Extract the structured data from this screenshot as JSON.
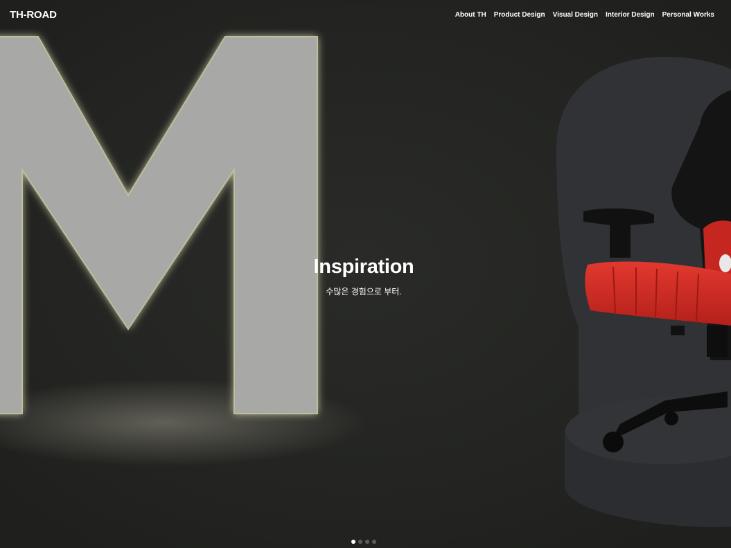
{
  "brand": {
    "logo": "TH-ROAD"
  },
  "nav": {
    "items": [
      {
        "label": "About TH"
      },
      {
        "label": "Product Design"
      },
      {
        "label": "Visual Design"
      },
      {
        "label": "Interior Design"
      },
      {
        "label": "Personal Works"
      }
    ]
  },
  "hero": {
    "headline": "Inspiration",
    "subline": "수많은 경험으로 부터.",
    "background_color": "#262724",
    "slides_total": 4,
    "active_slide": 1
  }
}
